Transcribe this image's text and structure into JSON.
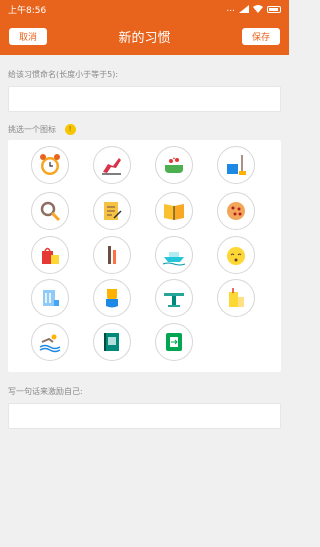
{
  "status_bar": {
    "time": "上午8:56",
    "icons_text": "..."
  },
  "header": {
    "cancel_label": "取消",
    "title": "新的习惯",
    "save_label": "保存"
  },
  "name_field": {
    "label": "给该习惯命名(长度小于等于5):",
    "value": ""
  },
  "icon_picker": {
    "label": "挑选一个图标",
    "hint_badge": "!",
    "icons": [
      "alarm-clock-icon",
      "running-shoe-icon",
      "bath-tub-icon",
      "cleaning-bucket-icon",
      "magnifier-icon",
      "contract-document-icon",
      "open-book-icon",
      "cookie-icon",
      "shopping-bag-icon",
      "toothbrush-icon",
      "boat-icon",
      "sleepy-face-icon",
      "shower-icon",
      "swimsuit-icon",
      "fitness-bar-icon",
      "juice-drink-icon",
      "swimming-icon",
      "notebook-icon",
      "exit-door-icon"
    ]
  },
  "motto_field": {
    "label": "写一句话来激励自己:",
    "value": ""
  },
  "colors": {
    "accent": "#e8641d",
    "background": "#f0f0f0"
  }
}
